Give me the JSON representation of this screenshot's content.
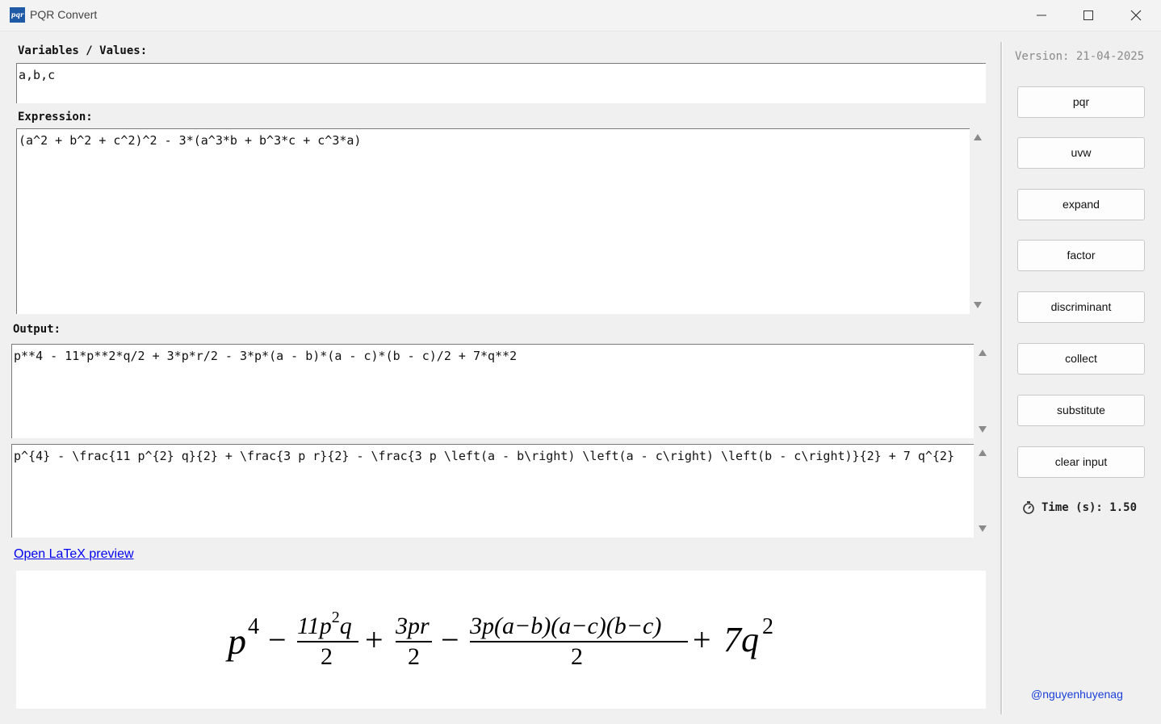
{
  "window": {
    "icon_text": "pqr",
    "title": "PQR Convert"
  },
  "inputs": {
    "variables_label": "Variables / Values:",
    "variables_value": "a,b,c",
    "expression_label": "Expression:",
    "expression_value": "(a^2 + b^2 + c^2)^2 - 3*(a^3*b + b^3*c + c^3*a)"
  },
  "output": {
    "label": "Output:",
    "python_value": "p**4 - 11*p**2*q/2 + 3*p*r/2 - 3*p*(a - b)*(a - c)*(b - c)/2 + 7*q**2",
    "latex_value": "p^{4} - \\frac{11 p^{2} q}{2} + \\frac{3 p r}{2} - \\frac{3 p \\left(a - b\\right) \\left(a - c\\right) \\left(b - c\\right)}{2} + 7 q^{2}",
    "preview_link": "Open LaTeX preview"
  },
  "preview": {
    "t1_base": "p",
    "t1_exp": "4",
    "minus": "−",
    "plus": "+",
    "f1_num_a": "11p",
    "f1_num_exp": "2",
    "f1_num_b": "q",
    "f1_den": "2",
    "f2_num": "3pr",
    "f2_den": "2",
    "f3_num": "3p(a−b)(a−c)(b−c)",
    "f3_den": "2",
    "t5_coef": "7q",
    "t5_exp": "2"
  },
  "sidebar": {
    "version": "Version: 21-04-2025",
    "buttons": [
      "pqr",
      "uvw",
      "expand",
      "factor",
      "discriminant",
      "collect",
      "substitute",
      "clear input"
    ],
    "timer_icon": "stopwatch-icon",
    "timer": "Time (s): 1.50",
    "credit": "@nguyenhuyenag"
  }
}
